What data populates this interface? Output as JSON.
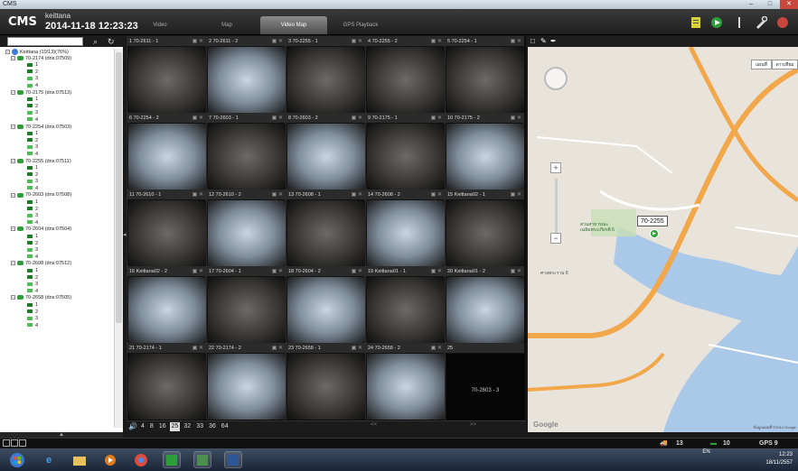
{
  "window": {
    "title": "CMS",
    "controls": [
      "–",
      "□",
      "✕"
    ]
  },
  "header": {
    "logo": "CMS",
    "user": "keittana",
    "datetime": "2014-11-18 12:23:23",
    "tabs": [
      {
        "label": "Video",
        "active": false
      },
      {
        "label": "Map",
        "active": false
      },
      {
        "label": "Video Map",
        "active": true
      },
      {
        "label": "GPS Playback",
        "active": false
      }
    ],
    "tools": [
      "list-icon",
      "record-icon",
      "info-icon",
      "settings-icon"
    ]
  },
  "tree": {
    "root": "Keittana  (10/13)(76%)",
    "vehicles": [
      {
        "name": "70-2174 (dns:07509)",
        "channels": [
          "1",
          "2",
          "3",
          "4"
        ]
      },
      {
        "name": "70-2175 (dns:07513)",
        "channels": [
          "1",
          "2",
          "3",
          "4"
        ]
      },
      {
        "name": "70-2254 (dns:07503)",
        "channels": [
          "1",
          "2",
          "3",
          "4"
        ]
      },
      {
        "name": "70-2255 (dns:07511)",
        "channels": [
          "1",
          "2",
          "3",
          "4"
        ]
      },
      {
        "name": "70-2603 (dns:07508)",
        "channels": [
          "1",
          "2",
          "3",
          "4"
        ]
      },
      {
        "name": "70-2604 (dns:07504)",
        "channels": [
          "1",
          "2",
          "3",
          "4"
        ]
      },
      {
        "name": "70-2608 (dns:07512)",
        "channels": [
          "1",
          "2",
          "3",
          "4"
        ]
      },
      {
        "name": "70-2658 (dns:07505)",
        "channels": [
          "1",
          "2",
          "3",
          "4"
        ]
      }
    ]
  },
  "grid": {
    "cells": [
      {
        "title": "1 70-2611 - 1",
        "style": "cab"
      },
      {
        "title": "2 70-2611 - 2",
        "style": "bright"
      },
      {
        "title": "3 70-2255 - 1",
        "style": "cab"
      },
      {
        "title": "4 70-2255 - 2",
        "style": "cab"
      },
      {
        "title": "5 70-2254 - 1",
        "style": "cab"
      },
      {
        "title": "6 70-2254 - 2",
        "style": "bright"
      },
      {
        "title": "7 70-2603 - 1",
        "style": "cab"
      },
      {
        "title": "8 70-2603 - 2",
        "style": "bright"
      },
      {
        "title": "9 70-2175 - 1",
        "style": "cab"
      },
      {
        "title": "10 70-2175 - 2",
        "style": "bright"
      },
      {
        "title": "11 70-2610 - 1",
        "style": "cab"
      },
      {
        "title": "12 70-2610 - 2",
        "style": "bright"
      },
      {
        "title": "13 70-2608 - 1",
        "style": "cab"
      },
      {
        "title": "14 70-2608 - 2",
        "style": "bright"
      },
      {
        "title": "15 Keittana02 - 1",
        "style": "cab"
      },
      {
        "title": "16 Keittana02 - 2",
        "style": "bright"
      },
      {
        "title": "17 70-2604 - 1",
        "style": "cab"
      },
      {
        "title": "18 70-2604 - 2",
        "style": "bright"
      },
      {
        "title": "19 Keittana01 - 1",
        "style": "cab"
      },
      {
        "title": "20 Keittana01 - 2",
        "style": "bright"
      },
      {
        "title": "21 70-2174 - 1",
        "style": "cab"
      },
      {
        "title": "22 70-2174 - 2",
        "style": "bright"
      },
      {
        "title": "23 70-2658 - 1",
        "style": "cab"
      },
      {
        "title": "24 70-2658 - 2",
        "style": "bright"
      },
      {
        "title": "25",
        "style": "black",
        "label": "70-2603 - 3"
      }
    ],
    "layouts": [
      "4",
      "8",
      "16",
      "25",
      "32",
      "33",
      "36",
      "64"
    ],
    "active_layout": "25",
    "prev": "<<",
    "next": ">>"
  },
  "map": {
    "types": [
      "แผนที่",
      "ดาวเทียม"
    ],
    "vehicle_label": "70-2255",
    "copyright": "ข้อมูลแผนที่ ©2014 Google",
    "google": "Google",
    "place_labels": [
      "ศาลพระราม 8",
      "สวนสาธารณะ เฉลิมพระเกียรติ 6"
    ]
  },
  "status": {
    "online": "13",
    "stop": "10",
    "gps": "GPS 9"
  },
  "taskbar": {
    "apps": [
      "start-icon",
      "ie-icon",
      "explorer-icon",
      "media-icon",
      "chrome-icon",
      "cms-icon",
      "app-icon",
      "word-icon"
    ],
    "lang": "EN",
    "time": "12:23",
    "date": "18/11/2557"
  },
  "colors": {
    "accent": "#2e9e3a",
    "road": "#f2a74a",
    "river": "#a9c7e6",
    "close": "#c9463d"
  }
}
